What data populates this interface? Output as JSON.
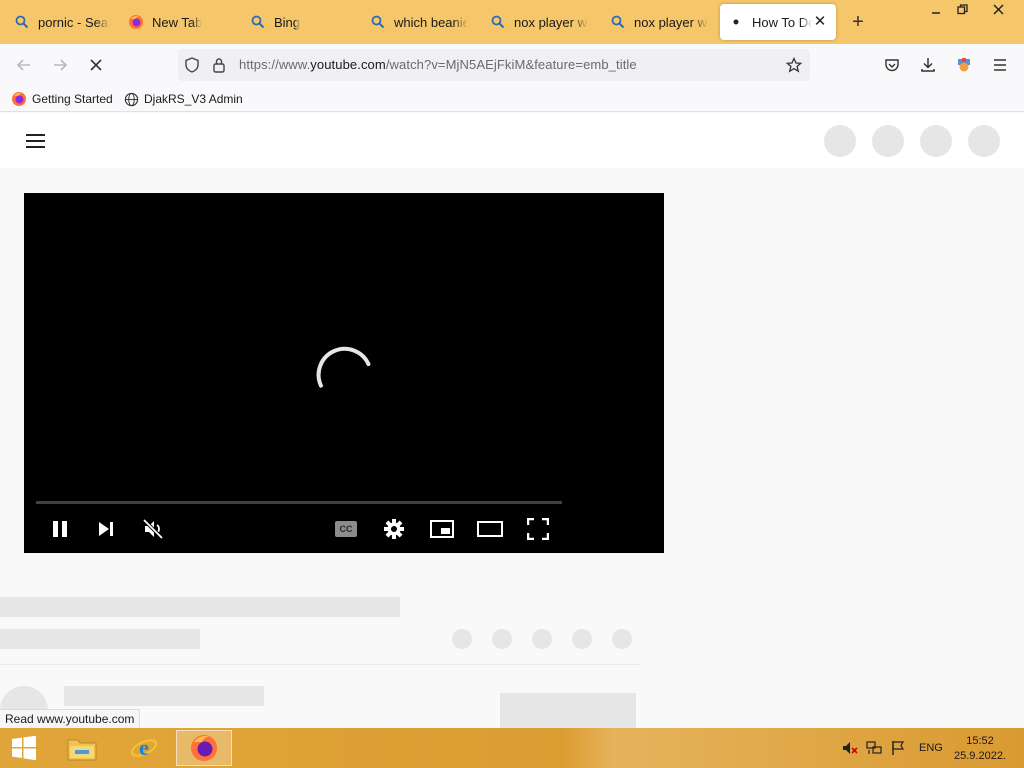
{
  "browser": {
    "tabs": [
      {
        "label": "pornic - Search",
        "icon": "search-icon"
      },
      {
        "label": "New Tab",
        "icon": "firefox-icon"
      },
      {
        "label": "Bing",
        "icon": "search-icon"
      },
      {
        "label": "which beanie bab",
        "icon": "search-icon"
      },
      {
        "label": "nox player with",
        "icon": "search-icon"
      },
      {
        "label": "nox player with",
        "icon": "search-icon"
      },
      {
        "label": "How To Do",
        "icon": "loading-dot-icon",
        "active": true
      }
    ],
    "url": {
      "prefix": "https://www.",
      "host": "youtube.com",
      "path": "/watch?v=MjN5AEjFkiM&feature=emb_title"
    },
    "bookmarks": [
      {
        "label": "Getting Started",
        "icon": "firefox-icon"
      },
      {
        "label": "DjakRS_V3 Admin",
        "icon": "globe-icon"
      }
    ],
    "status_text": "Read www.youtube.com"
  },
  "player": {
    "state": "loading",
    "muted": true,
    "controls": [
      "pause",
      "next",
      "mute",
      "captions",
      "settings",
      "miniplayer",
      "theater",
      "fullscreen"
    ],
    "captions_label": "CC"
  },
  "taskbar": {
    "apps": [
      "file-explorer-icon",
      "internet-explorer-icon",
      "firefox-icon"
    ],
    "active_app": "firefox-icon",
    "language": "ENG",
    "time": "15:52",
    "date": "25.9.2022."
  },
  "colors": {
    "tabstrip": "#f5c66a",
    "taskbar": "#e1a63a",
    "player_bg": "#000000",
    "skeleton": "#e6e6e6"
  }
}
